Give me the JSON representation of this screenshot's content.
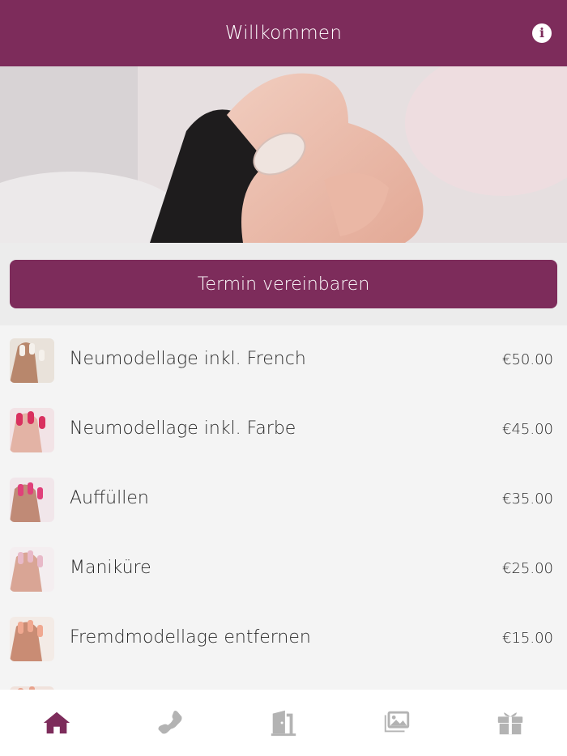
{
  "header": {
    "title": "Willkommen",
    "info_icon": "info-icon"
  },
  "hero": {
    "image": "manicured-hand-photo"
  },
  "cta": {
    "label": "Termin vereinbaren"
  },
  "services": [
    {
      "name": "Neumodellage inkl. French",
      "price": "€50.00",
      "thumb_color": "#d8b4a0"
    },
    {
      "name": "Neumodellage inkl. Farbe",
      "price": "€45.00",
      "thumb_color": "#d9305f"
    },
    {
      "name": "Auffüllen",
      "price": "€35.00",
      "thumb_color": "#e0407a"
    },
    {
      "name": "Maniküre",
      "price": "€25.00",
      "thumb_color": "#e8b9c8"
    },
    {
      "name": "Fremdmodellage entfernen",
      "price": "€15.00",
      "thumb_color": "#f0a890"
    }
  ],
  "tabs": [
    {
      "icon": "home-icon",
      "active": true
    },
    {
      "icon": "phone-icon",
      "active": false
    },
    {
      "icon": "door-icon",
      "active": false
    },
    {
      "icon": "gallery-icon",
      "active": false
    },
    {
      "icon": "gift-icon",
      "active": false
    }
  ],
  "colors": {
    "brand": "#7d2c5b",
    "tab_inactive": "#b3b3b3"
  }
}
